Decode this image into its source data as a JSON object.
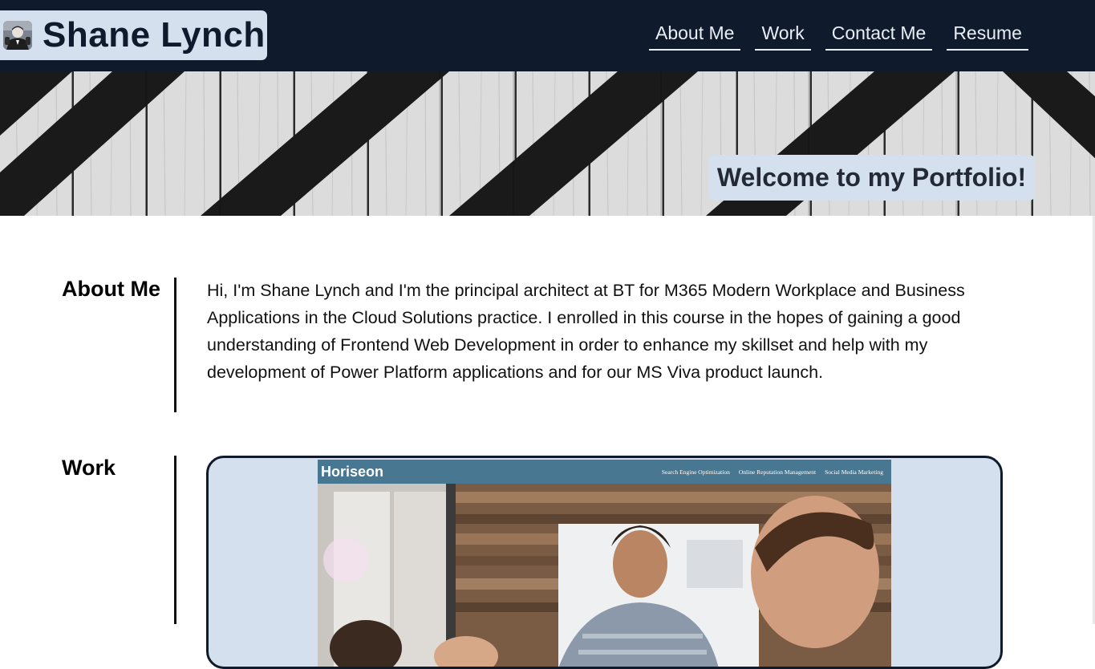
{
  "header": {
    "name": "Shane Lynch",
    "avatar_icon": "profile-photo",
    "nav": [
      {
        "label": "About Me"
      },
      {
        "label": "Work"
      },
      {
        "label": "Contact Me"
      },
      {
        "label": "Resume"
      }
    ]
  },
  "hero": {
    "welcome": "Welcome to my Portfolio!"
  },
  "about": {
    "heading": "About Me",
    "text": "Hi, I'm Shane Lynch and I'm the principal architect at BT for M365 Modern Workplace and Business Applications in the Cloud Solutions practice. I enrolled in this course in the hopes of gaining a good understanding of Frontend Web Development in order to enhance my skillset and help with my development of Power Platform applications and for our MS Viva product launch."
  },
  "work": {
    "heading": "Work",
    "project": {
      "brand": "Horiseon",
      "links": [
        "Search Engine Optimization",
        "Online Reputation Management",
        "Social Media Marketing"
      ]
    }
  },
  "colors": {
    "header_bg": "#0f1a2c",
    "accent_light": "#d4e0ee",
    "project_bar": "#477791"
  }
}
